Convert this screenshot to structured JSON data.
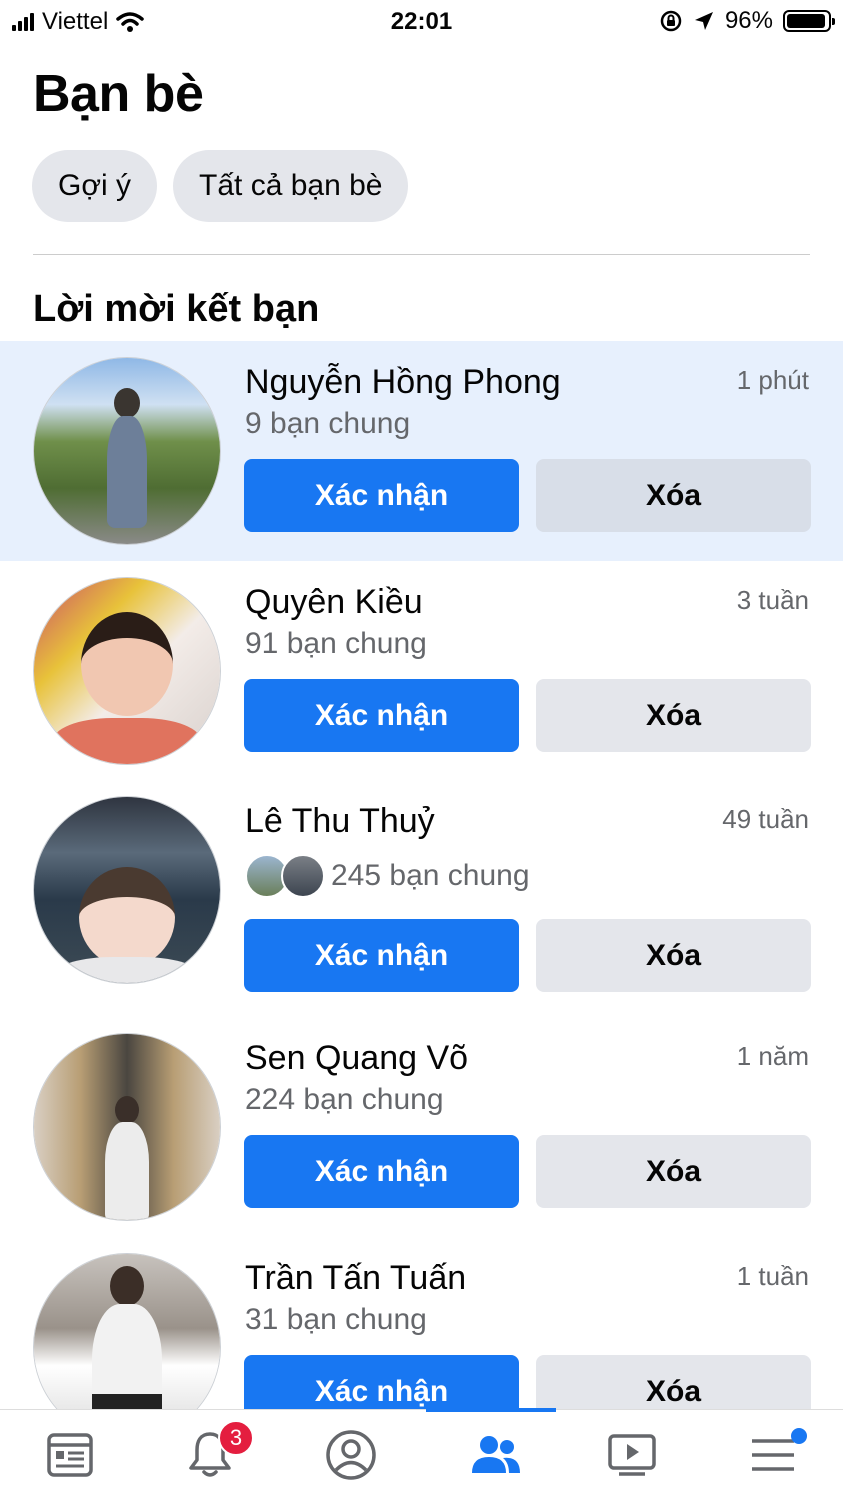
{
  "status_bar": {
    "carrier": "Viettel",
    "time": "22:01",
    "battery": "96%",
    "battery_level": 0.96
  },
  "header": {
    "title": "Bạn bè",
    "chips": [
      "Gợi ý",
      "Tất cả bạn bè"
    ]
  },
  "section": {
    "title": "Lời mời kết bạn"
  },
  "requests": [
    {
      "name": "Nguyễn Hồng Phong",
      "time": "1 phút",
      "mutual": "9 bạn chung",
      "confirm": "Xác nhận",
      "delete": "Xóa",
      "highlighted": true
    },
    {
      "name": "Quyên Kiều",
      "time": "3 tuần",
      "mutual": "91 bạn chung",
      "confirm": "Xác nhận",
      "delete": "Xóa"
    },
    {
      "name": "Lê Thu Thuỷ",
      "time": "49 tuần",
      "mutual": "245 bạn chung",
      "confirm": "Xác nhận",
      "delete": "Xóa"
    },
    {
      "name": "Sen Quang Võ",
      "time": "1 năm",
      "mutual": "224 bạn chung",
      "confirm": "Xác nhận",
      "delete": "Xóa"
    },
    {
      "name": "Trần Tấn Tuấn",
      "time": "1 tuần",
      "mutual": "31 bạn chung",
      "confirm": "Xác nhận",
      "delete": "Xóa"
    }
  ],
  "bottom_nav": {
    "items": [
      "news-feed-icon",
      "notifications-icon",
      "profile-icon",
      "friends-icon",
      "watch-icon",
      "menu-icon"
    ],
    "active": "friends-icon",
    "notification_badge": "3"
  },
  "colors": {
    "accent": "#1877f2",
    "highlight": "#e7f0fd",
    "badge": "#e41e3f",
    "secondary_text": "#65676b"
  }
}
